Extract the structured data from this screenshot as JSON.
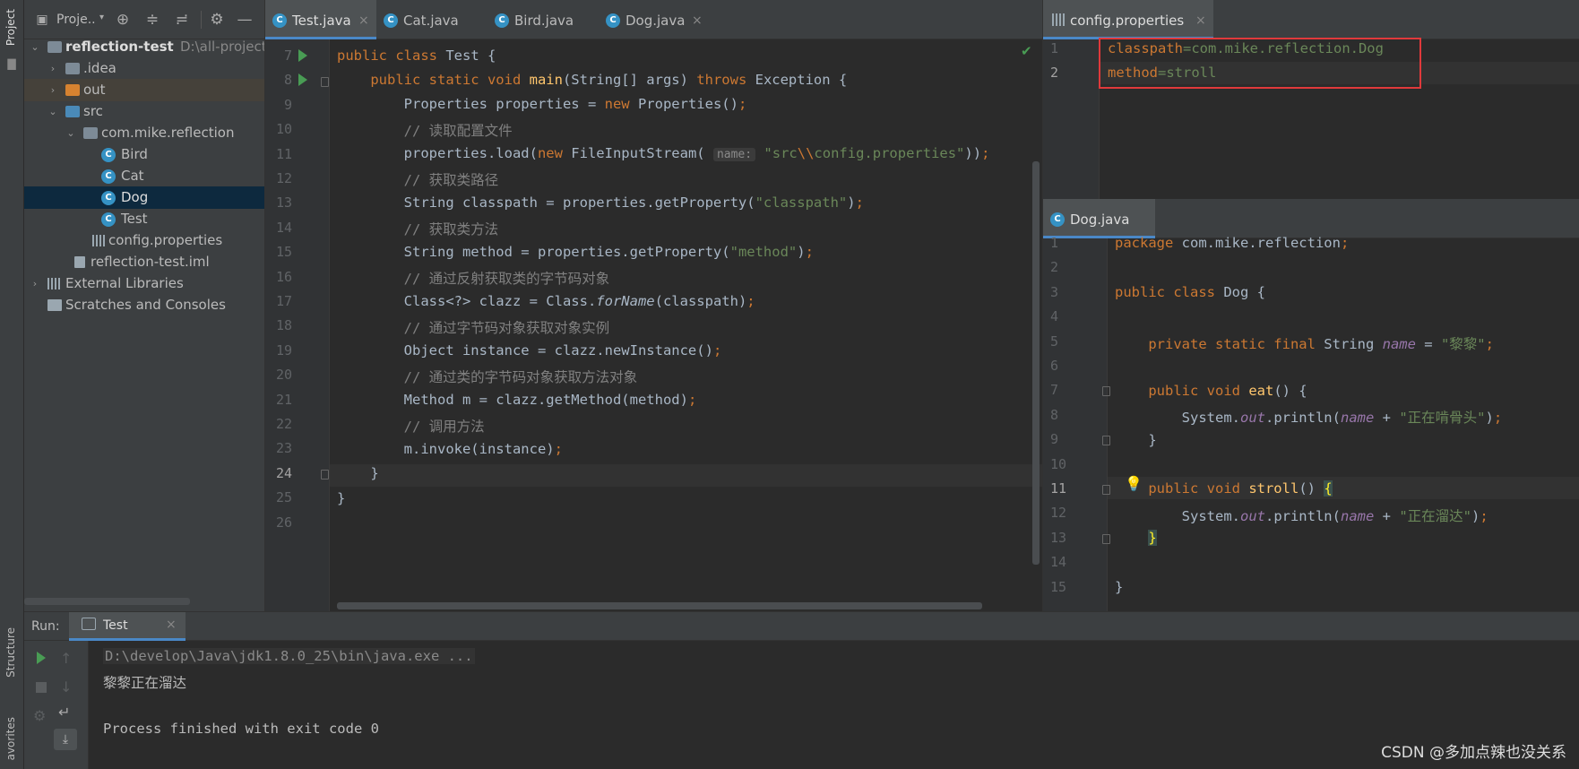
{
  "side_tabs": {
    "project": "Project",
    "structure": "Structure",
    "favorites": "avorites"
  },
  "project": {
    "title": "Proje..",
    "tree": [
      {
        "label": "reflection-test",
        "path": "D:\\all-project\\",
        "type": "module"
      },
      {
        "label": ".idea",
        "type": "folder"
      },
      {
        "label": "out",
        "type": "folder-excluded"
      },
      {
        "label": "src",
        "type": "folder-source"
      },
      {
        "label": "com.mike.reflection",
        "type": "package"
      },
      {
        "label": "Bird",
        "type": "class"
      },
      {
        "label": "Cat",
        "type": "class"
      },
      {
        "label": "Dog",
        "type": "class",
        "selected": true
      },
      {
        "label": "Test",
        "type": "class"
      },
      {
        "label": "config.properties",
        "type": "properties"
      },
      {
        "label": "reflection-test.iml",
        "type": "iml"
      },
      {
        "label": "External Libraries",
        "type": "libraries"
      },
      {
        "label": "Scratches and Consoles",
        "type": "scratches"
      }
    ]
  },
  "editor_left": {
    "tabs": [
      "Test.java",
      "Cat.java",
      "Bird.java",
      "Dog.java"
    ],
    "active_tab": "Test.java",
    "line_numbers": [
      "7",
      "8",
      "9",
      "10",
      "11",
      "12",
      "13",
      "14",
      "15",
      "16",
      "17",
      "18",
      "19",
      "20",
      "21",
      "22",
      "23",
      "24",
      "25",
      "26"
    ],
    "current_line": "24",
    "hint_label": "name:"
  },
  "editor_config": {
    "tab": "config.properties",
    "line_numbers": [
      "1",
      "2"
    ],
    "lines": [
      {
        "key": "classpath",
        "sep": "=",
        "value": "com.mike.reflection.Dog"
      },
      {
        "key": "method",
        "sep": "=",
        "value": "stroll"
      }
    ]
  },
  "editor_dog": {
    "tab": "Dog.java",
    "line_numbers": [
      "1",
      "2",
      "3",
      "4",
      "5",
      "6",
      "7",
      "8",
      "9",
      "10",
      "11",
      "12",
      "13",
      "14",
      "15"
    ],
    "current_line": "11"
  },
  "run": {
    "label": "Run:",
    "tab": "Test",
    "output": [
      "D:\\develop\\Java\\jdk1.8.0_25\\bin\\java.exe ...",
      "黎黎正在溜达",
      "",
      "Process finished with exit code 0"
    ]
  },
  "watermark": "CSDN @多加点辣也没关系",
  "colors": {
    "keyword": "#cc7832",
    "string": "#6a8759",
    "comment": "#808080",
    "method": "#ffc66d",
    "field": "#9876aa",
    "highlight": "#e0393b",
    "selection": "#0d293e"
  }
}
